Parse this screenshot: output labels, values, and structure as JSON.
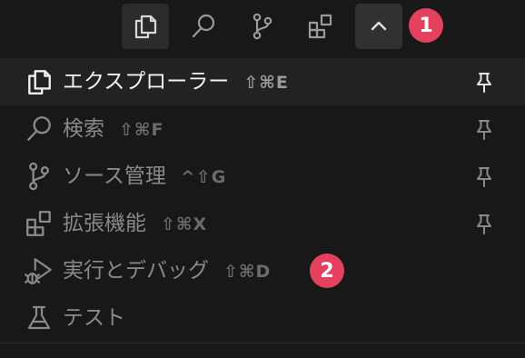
{
  "toolbar": {
    "buttons": [
      {
        "icon": "explorer-icon",
        "active": true
      },
      {
        "icon": "search-icon",
        "active": false
      },
      {
        "icon": "source-control-icon",
        "active": false
      },
      {
        "icon": "extensions-icon",
        "active": false
      },
      {
        "icon": "chevron-up-icon",
        "active": false
      }
    ],
    "badge_1": "1"
  },
  "menu": {
    "items": [
      {
        "label": "エクスプローラー",
        "shortcut": "⇧⌘E",
        "icon": "explorer-icon",
        "pinned": true,
        "selected": true
      },
      {
        "label": "検索",
        "shortcut": "⇧⌘F",
        "icon": "search-icon",
        "pinned": true,
        "selected": false
      },
      {
        "label": "ソース管理",
        "shortcut": "^⇧G",
        "icon": "source-control-icon",
        "pinned": true,
        "selected": false
      },
      {
        "label": "拡張機能",
        "shortcut": "⇧⌘X",
        "icon": "extensions-icon",
        "pinned": true,
        "selected": false
      },
      {
        "label": "実行とデバッグ",
        "shortcut": "⇧⌘D",
        "icon": "run-debug-icon",
        "pinned": false,
        "selected": false
      },
      {
        "label": "テスト",
        "shortcut": "",
        "icon": "testing-icon",
        "pinned": false,
        "selected": false
      }
    ],
    "badge_2": "2"
  },
  "colors": {
    "background": "#181818",
    "selected_row": "#222222",
    "badge": "#e5405e",
    "text_active": "#f2f2f2",
    "text_inactive": "#8a8a8a"
  }
}
